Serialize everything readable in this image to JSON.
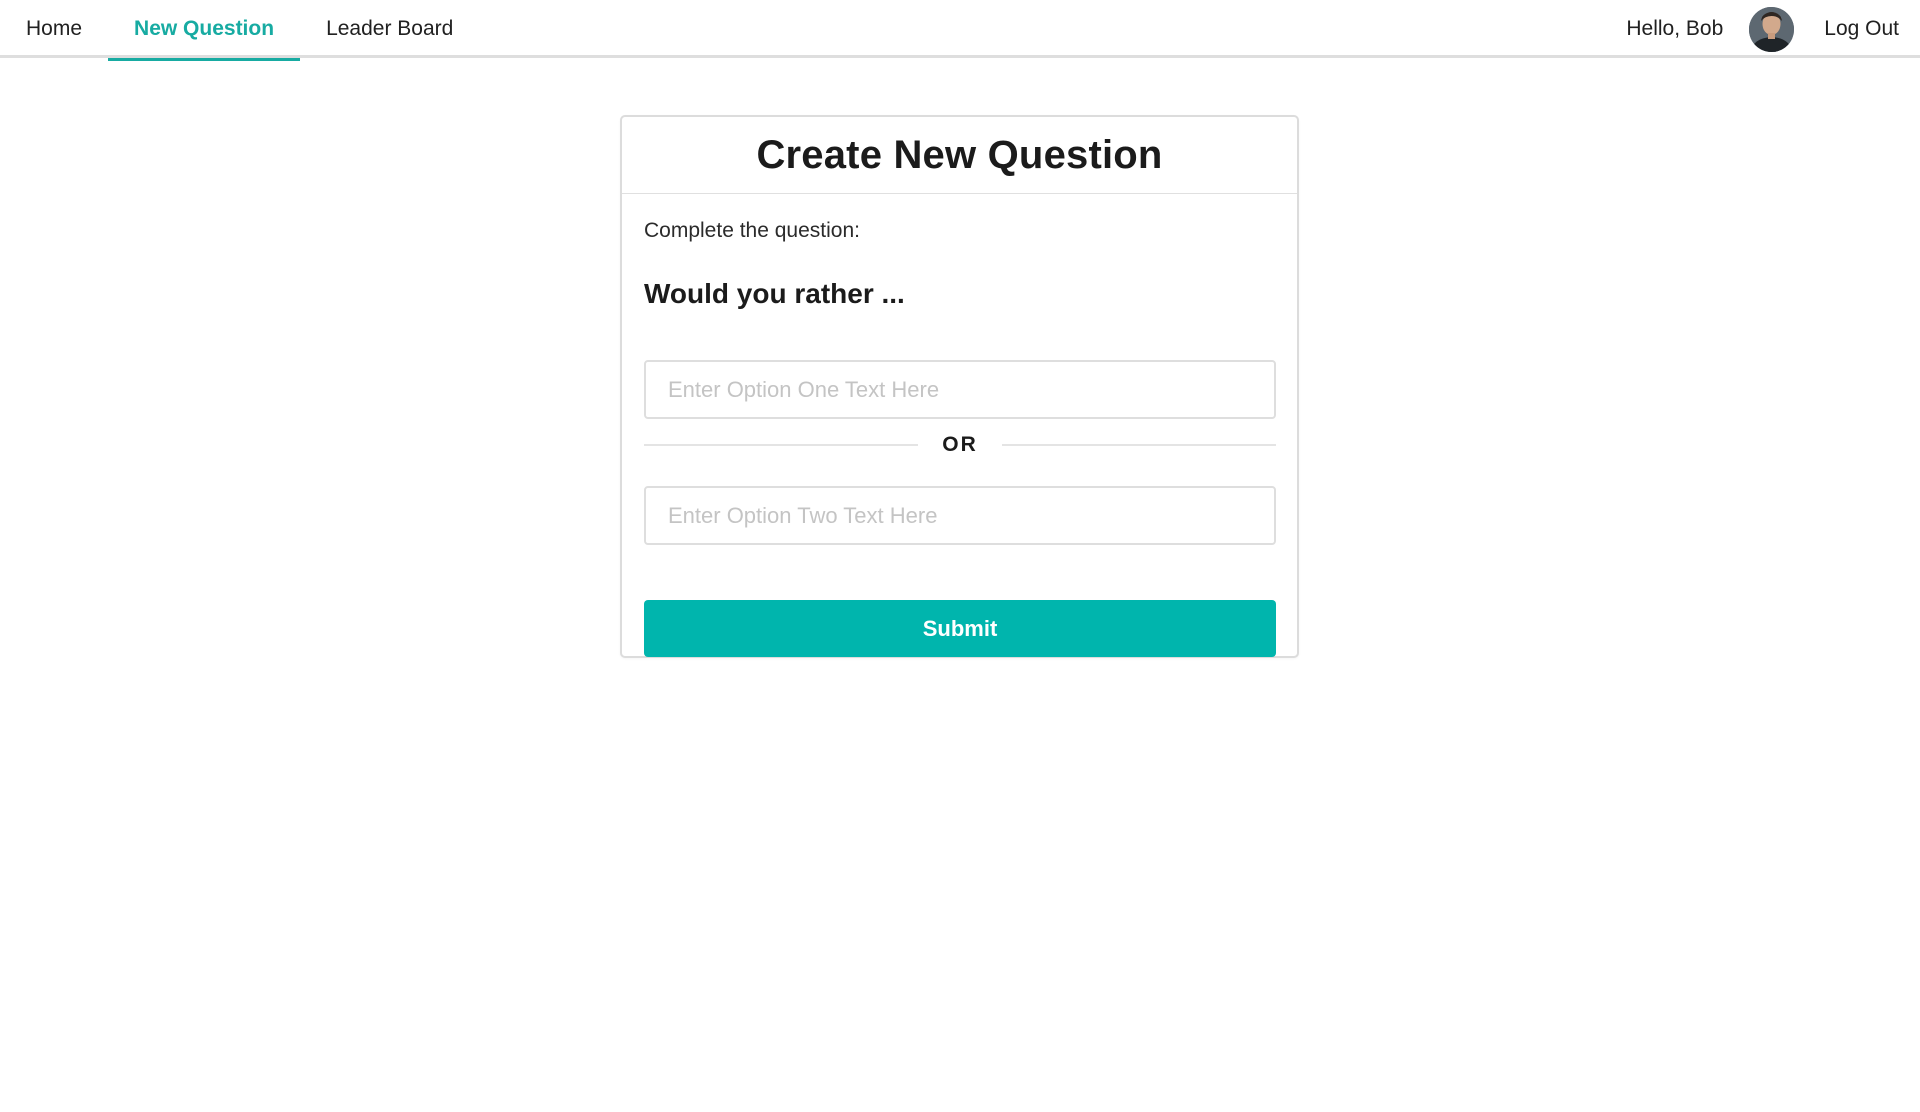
{
  "nav": {
    "items": [
      {
        "label": "Home",
        "active": false
      },
      {
        "label": "New Question",
        "active": true
      },
      {
        "label": "Leader Board",
        "active": false
      }
    ],
    "greeting": "Hello, Bob",
    "avatar_icon": "user-avatar-icon",
    "logout_label": "Log Out"
  },
  "card": {
    "title": "Create New Question",
    "instruction": "Complete the question:",
    "question_lead": "Would you rather ...",
    "option_one": {
      "placeholder": "Enter Option One Text Here",
      "value": ""
    },
    "divider_label": "OR",
    "option_two": {
      "placeholder": "Enter Option Two Text Here",
      "value": ""
    },
    "submit_label": "Submit"
  },
  "colors": {
    "accent": "#17aba2",
    "button": "#00b5ad",
    "border": "#dedede"
  }
}
